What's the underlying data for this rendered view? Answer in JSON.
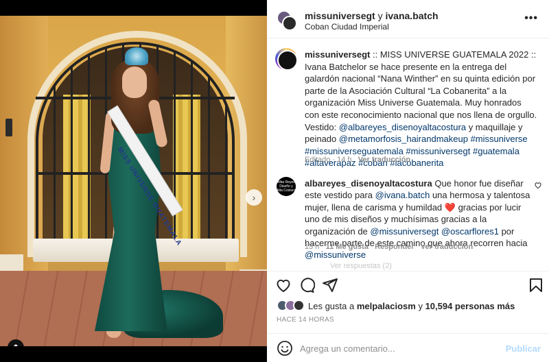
{
  "post": {
    "photo_dots": 11,
    "active_dot": 0
  },
  "header": {
    "user_a": "missuniversegt",
    "conj": " y ",
    "user_b": "ivana.batch",
    "location": "Coban Ciudad Imperial",
    "more_icon": "more-horizontal-icon"
  },
  "photo": {
    "sash_text": "MISS UNIVERSE GUATEMALA"
  },
  "caption": {
    "username": "missuniversegt",
    "text": " :: MISS UNIVERSE GUATEMALA 2022 :: Ivana Batchelor se hace presente en la entrega del galardón nacional “Nana Winther” en su quinta edición por parte de la Asociación Cultural “La Cobanerita” a la organización Miss Universe Guatemala. Muy honrados con este reconocimiento nacional que nos llena de orgullo. Vestido: ",
    "link1": "@albareyes_disenoyaltacostura",
    "text2": " y maquillaje y peinado ",
    "link2": "@metamorfosis_hairandmakeup",
    "link3": "#missuniverse",
    "link4": "#missuniverseguatemala",
    "link5": "#missuniversegt",
    "link6": "#guatemala",
    "link7": "#altaverapaz",
    "link8": "#coban",
    "link9": "#lacobanerita",
    "edited": "Editado · 14 h",
    "translate": "Ver traducción"
  },
  "comment": {
    "avatar_text": "Alba Reyes Diseño y Alta Costura",
    "username": "albareyes_disenoyaltacostura",
    "t1": " Que honor fue diseñar este vestido para ",
    "link1": "@ivana.batch",
    "t2": " una hermosa y talentosa mujer, llena de carisma y humildad ",
    "heart": "❤️",
    "t3": " gracias por lucir uno de mis diseños y muchísimas gracias a la organización de ",
    "link2": "@missuniversegt",
    "link3": "@oscarflores1",
    "t4": " por hacerme parte de este camino que ahora recorren hacia ",
    "link4": "@missuniverse",
    "time": "13 h",
    "likes": "11 Me gusta",
    "reply": "Responder",
    "translate": "Ver traducción",
    "more_replies": "Ver respuestas (2)"
  },
  "likes": {
    "prefix": "Les gusta a ",
    "user": "melpalaciosm",
    "mid": " y ",
    "count": "10,594 personas más"
  },
  "time_ago": "HACE 14 HORAS",
  "comment_bar": {
    "placeholder": "Agrega un comentario...",
    "publish": "Publicar"
  },
  "colors": {
    "link": "#00376b",
    "muted": "#8e8e8e",
    "publish_disabled": "#b3dbff"
  }
}
